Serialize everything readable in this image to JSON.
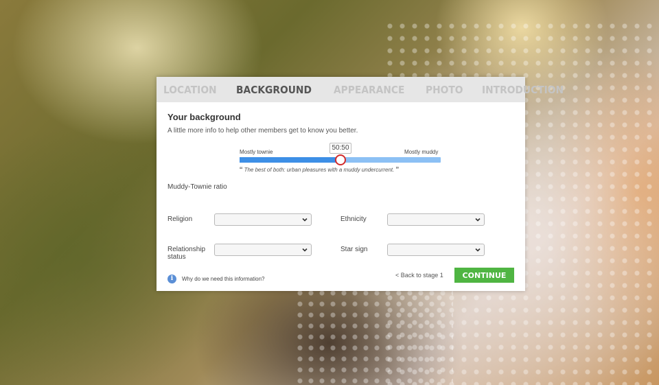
{
  "tabs": [
    {
      "label": "LOCATION",
      "active": false
    },
    {
      "label": "BACKGROUND",
      "active": true
    },
    {
      "label": "APPEARANCE",
      "active": false
    },
    {
      "label": "PHOTO",
      "active": false
    },
    {
      "label": "INTRODUCTION",
      "active": false
    }
  ],
  "form": {
    "title": "Your background",
    "subtitle": "A little more info to help other members get to know you better."
  },
  "slider": {
    "label": "Muddy-Townie ratio",
    "min_label": "Mostly townie",
    "max_label": "Mostly muddy",
    "value_text": "50:50",
    "fraction": 0.5,
    "quote": "The best of both: urban pleasures with a muddy undercurrent."
  },
  "fields": {
    "religion": {
      "label": "Religion",
      "value": ""
    },
    "ethnicity": {
      "label": "Ethnicity",
      "value": ""
    },
    "relationship": {
      "label": "Relationship status",
      "value": ""
    },
    "star_sign": {
      "label": "Star sign",
      "value": ""
    }
  },
  "footer": {
    "info_text": "Why do we need this information?",
    "back_label": "< Back to stage 1",
    "continue_label": "CONTINUE"
  },
  "colors": {
    "accent": "#3d8fe6",
    "continue": "#4fb542",
    "knob": "#d22a2a"
  },
  "icons": [
    "info-icon",
    "chevron-down-icon"
  ]
}
